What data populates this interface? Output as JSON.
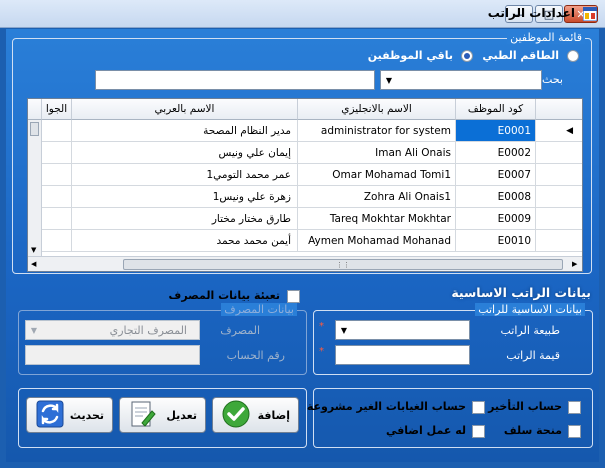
{
  "window": {
    "title": "اعدادات الراتب"
  },
  "employees_group": {
    "title": "قائمة الموظفين",
    "radio_medical": "الطاقم الطبي",
    "radio_other": "باقي الموظفين",
    "search_label": "بحث ب"
  },
  "grid": {
    "headers": {
      "code": "كود الموظف",
      "english": "الاسم بالانجليزي",
      "arabic": "الاسم بالعربي",
      "mobile": "الجوا"
    },
    "rows": [
      {
        "code": "E0001",
        "english": "administrator for system",
        "arabic": "مدير النظام المصحة"
      },
      {
        "code": "E0002",
        "english": "Iman Ali Onais",
        "arabic": "إيمان علي ونيس"
      },
      {
        "code": "E0007",
        "english": "Omar Mohamad Tomi1",
        "arabic": "عمر محمد التومي1"
      },
      {
        "code": "E0008",
        "english": "Zohra Ali Onais1",
        "arabic": "زهرة علي ونيس1"
      },
      {
        "code": "E0009",
        "english": "Tareq Mokhtar Mokhtar",
        "arabic": "طارق مختار مختار"
      },
      {
        "code": "E0010",
        "english": "Aymen Mohamad Mohanad",
        "arabic": "أيمن محمد محمد"
      }
    ]
  },
  "salary_section": {
    "title": "بيانات الراتب الاساسية",
    "basic_group_title": "بيانات الاساسية للراتب",
    "salary_type_label": "طبيعة الراتب",
    "salary_value_label": "قيمة الراتب",
    "required_mark": "*"
  },
  "bank": {
    "checkbox_label": "تعبئة بيانات المصرف",
    "group_title": "بيانات المصرف",
    "bank_label": "المصرف",
    "bank_value": "المصرف التجاري",
    "account_label": "رقم الحساب"
  },
  "options": {
    "late_calc": "حساب التأخير",
    "absence_calc": "حساب الغيابات الغير مشروعة",
    "advance_grant": "منحة سلف",
    "extra_work": "له عمل اضافي"
  },
  "buttons": {
    "add": "إضافة",
    "edit": "تعديل",
    "refresh": "تحديث"
  }
}
